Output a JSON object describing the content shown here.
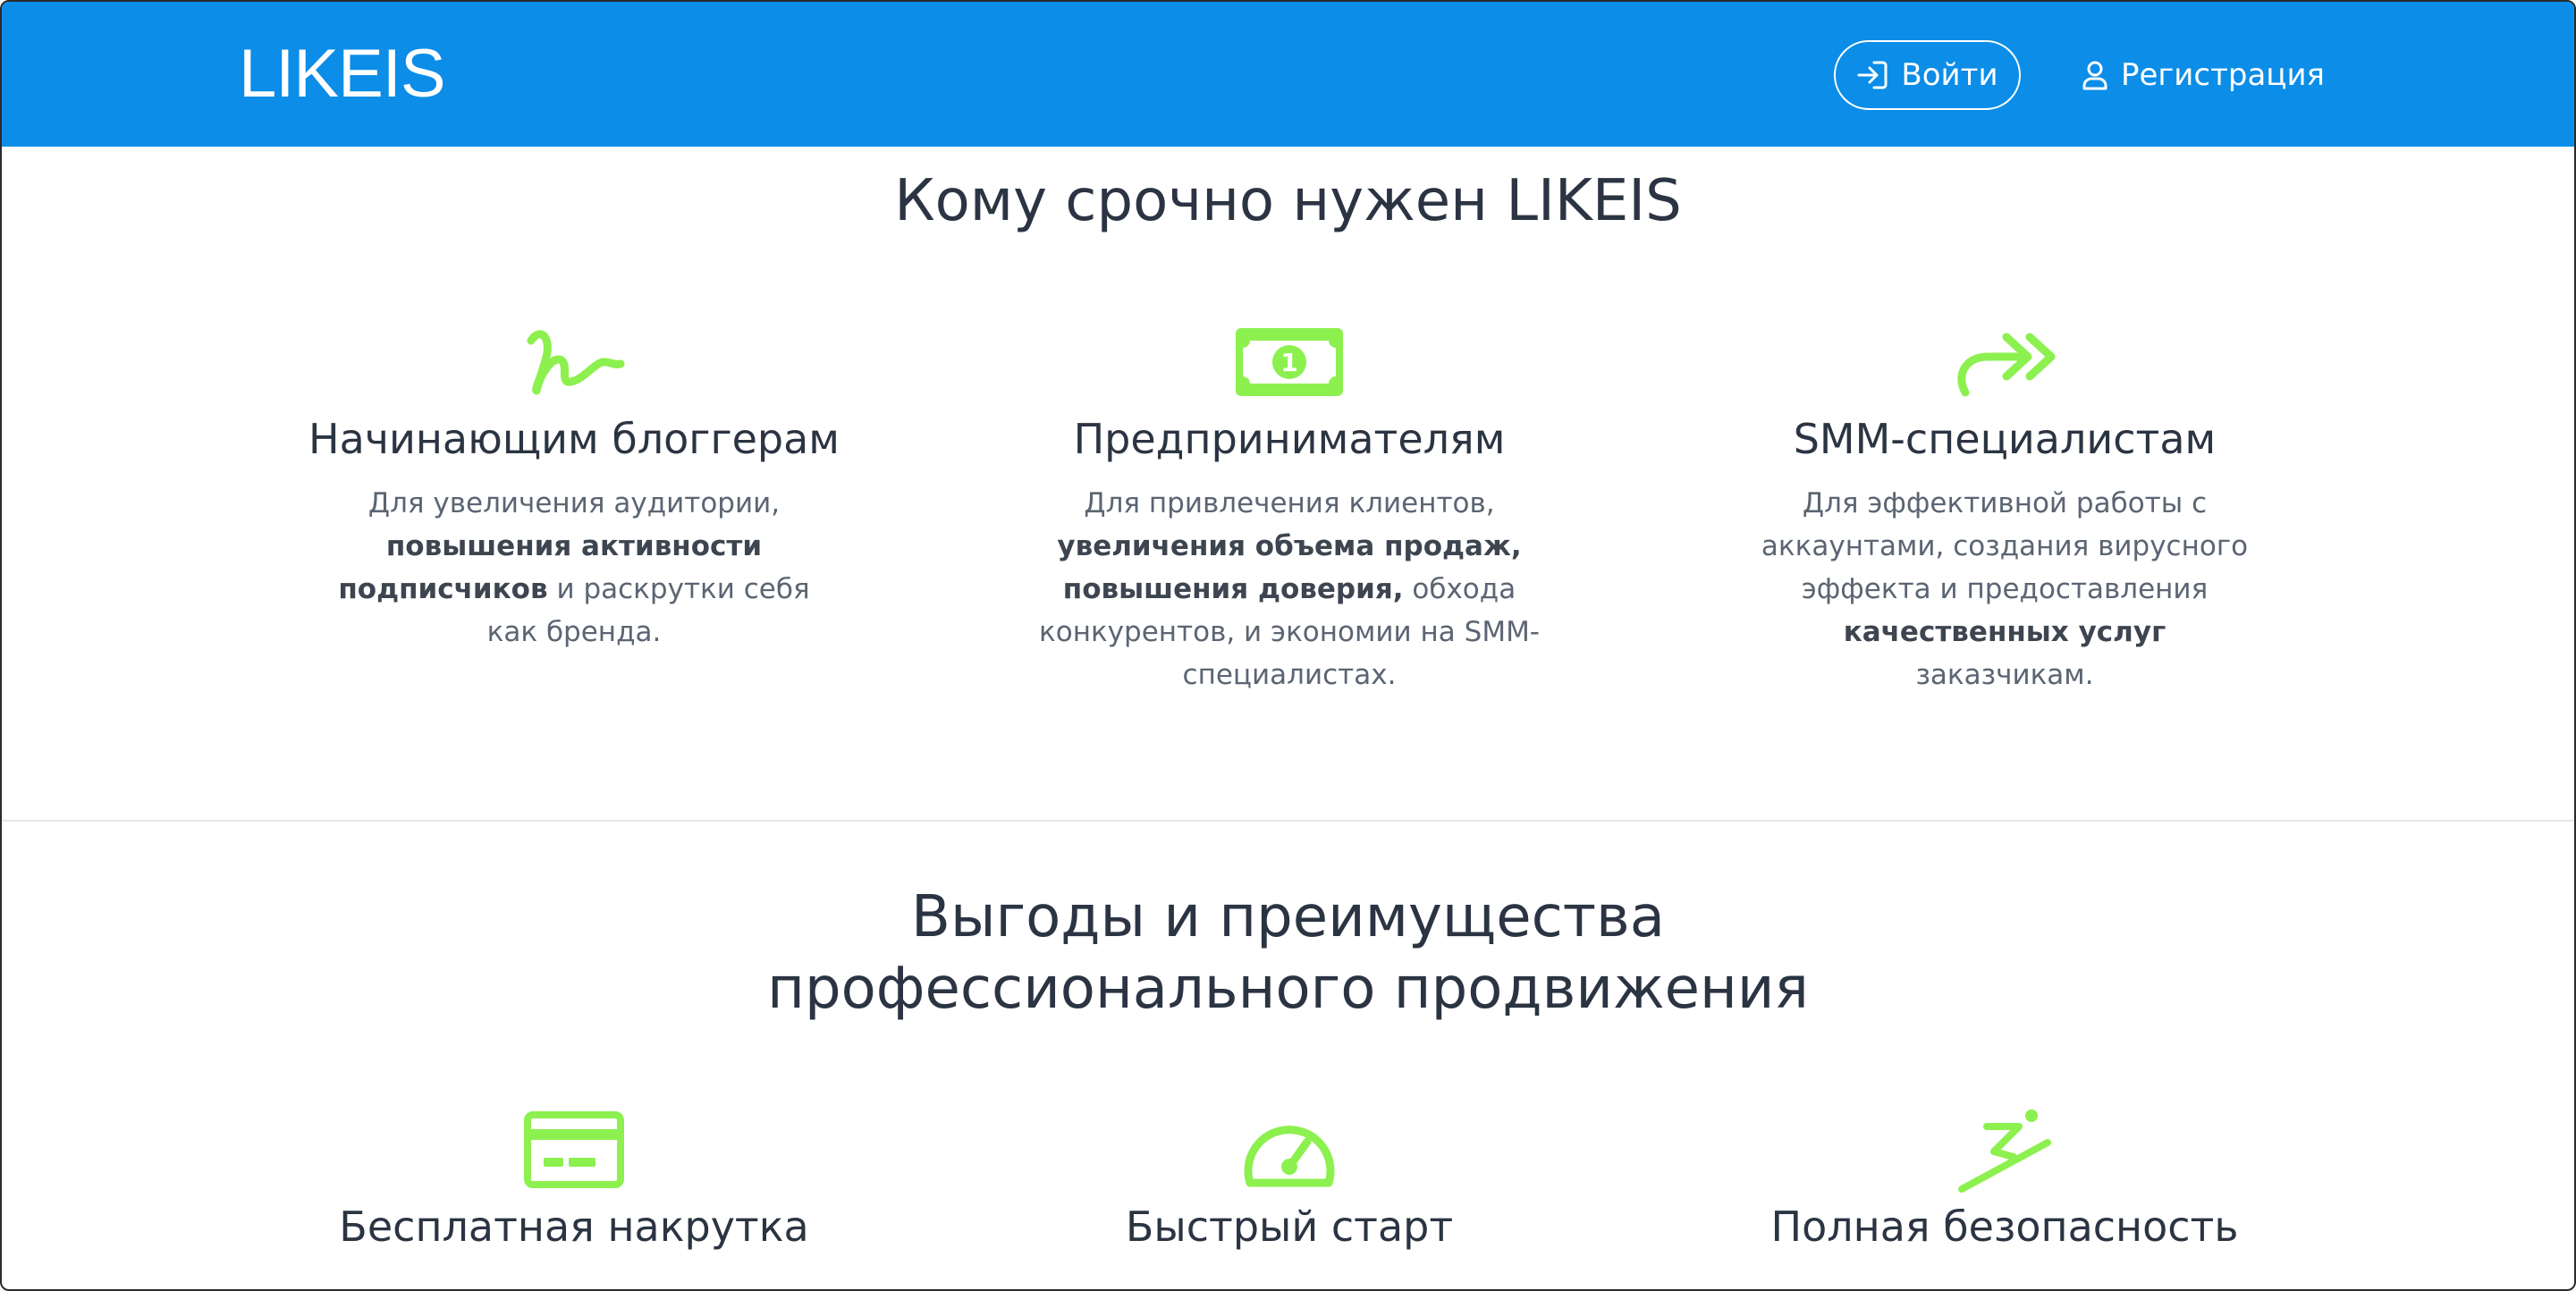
{
  "header": {
    "logo": "LIKEIS",
    "login_label": "Войти",
    "register_label": "Регистрация",
    "brand_color": "#0b8de8",
    "icons": {
      "login": "login-icon",
      "register": "user-icon"
    }
  },
  "audience": {
    "title": "Кому срочно нужен LIKEIS",
    "items": [
      {
        "icon": "signature-icon",
        "heading": "Начинающим блоггерам",
        "desc": [
          {
            "t": "Для увеличения аудитории, "
          },
          {
            "t": "повышения активности подписчиков",
            "b": true
          },
          {
            "t": " и раскрутки себя как бренда."
          }
        ]
      },
      {
        "icon": "money-bill-icon",
        "heading": "Предпринимателям",
        "desc": [
          {
            "t": "Для привлечения клиентов, "
          },
          {
            "t": "увеличения объема продаж, повышения доверия,",
            "b": true
          },
          {
            "t": " обхода конкурентов, и экономии на SMM-специалистах."
          }
        ]
      },
      {
        "icon": "share-forward-icon",
        "heading": "SMM-специалистам",
        "desc": [
          {
            "t": "Для эффективной работы с аккаунтами, создания вирусного эффекта и предоставления "
          },
          {
            "t": "качественных услуг",
            "b": true
          },
          {
            "t": " заказчикам."
          }
        ]
      }
    ]
  },
  "benefits": {
    "title_line1": "Выгоды и преимущества",
    "title_line2": "профессионального продвижения",
    "items": [
      {
        "icon": "credit-card-icon",
        "heading": "Бесплатная накрутка"
      },
      {
        "icon": "speedometer-icon",
        "heading": "Быстрый старт"
      },
      {
        "icon": "ski-jump-icon",
        "heading": "Полная безопасность"
      }
    ]
  },
  "accent_color": "#8cf04f",
  "text_color": "#2b3442"
}
